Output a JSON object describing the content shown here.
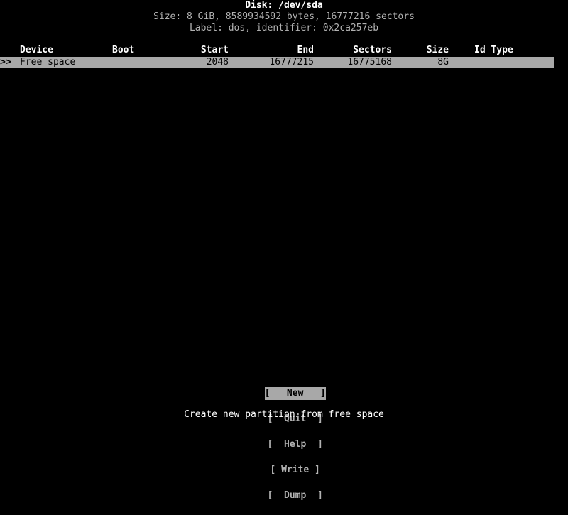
{
  "app": {
    "name": "cfdisk",
    "background_color": "#000000",
    "foreground_color": "#b2b2b2",
    "highlight_color": "#a8a8a8",
    "highlight_text_color": "#000000"
  },
  "header": {
    "disk_title": "Disk: /dev/sda",
    "size_line": "Size: 8 GiB, 8589934592 bytes, 16777216 sectors",
    "label_line": "Label: dos, identifier: 0x2ca257eb"
  },
  "table": {
    "columns": [
      {
        "key": "device",
        "label": "Device",
        "align": "left"
      },
      {
        "key": "boot",
        "label": "Boot",
        "align": "left"
      },
      {
        "key": "start",
        "label": "Start",
        "align": "right"
      },
      {
        "key": "end",
        "label": "End",
        "align": "right"
      },
      {
        "key": "sectors",
        "label": "Sectors",
        "align": "right"
      },
      {
        "key": "size",
        "label": "Size",
        "align": "right"
      },
      {
        "key": "idtype",
        "label": "Id Type",
        "align": "left"
      }
    ],
    "rows": [
      {
        "selected": true,
        "marker": ">>",
        "device": "Free space",
        "boot": "",
        "start": "2048",
        "end": "16777215",
        "sectors": "16775168",
        "size": "8G",
        "idtype": ""
      }
    ]
  },
  "menu": {
    "selected_index": 0,
    "buttons": [
      {
        "name": "new",
        "text": "[   New   ]"
      },
      {
        "name": "quit",
        "text": "[  Quit  ]"
      },
      {
        "name": "help",
        "text": "[  Help  ]"
      },
      {
        "name": "write",
        "text": "[ Write ]"
      },
      {
        "name": "dump",
        "text": "[  Dump  ]"
      }
    ],
    "separator": "  "
  },
  "footer": {
    "hint": "Create new partition from free space"
  }
}
